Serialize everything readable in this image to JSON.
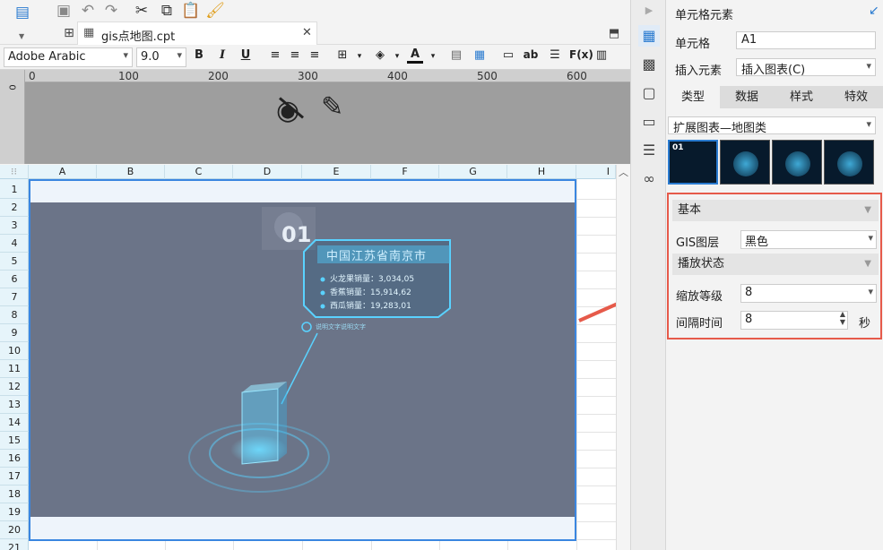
{
  "file_tab": {
    "name": "gis点地图.cpt"
  },
  "format_bar": {
    "font": "Adobe Arabic",
    "size": "9.0",
    "bold": "B",
    "italic": "I",
    "underline": "U",
    "fx": "F(x)"
  },
  "ruler": {
    "ticks": [
      "0",
      "100",
      "200",
      "300",
      "400",
      "500",
      "600"
    ]
  },
  "side_ruler": "0",
  "columns": [
    "A",
    "B",
    "C",
    "D",
    "E",
    "F",
    "G",
    "H",
    "I"
  ],
  "rows": [
    "1",
    "2",
    "3",
    "4",
    "5",
    "6",
    "7",
    "8",
    "9",
    "10",
    "11",
    "12",
    "13",
    "14",
    "15",
    "16",
    "17",
    "18",
    "19",
    "20",
    "21"
  ],
  "chart": {
    "badge": "01",
    "city": "中国江苏省南京市",
    "lines": [
      "火龙果销量：3,034,05",
      "香蕉销量：15,914,62",
      "西瓜销量：19,283,01"
    ],
    "note": "说明文字说明文字"
  },
  "panel": {
    "title": "单元格元素",
    "cell_label": "单元格",
    "cell_value": "A1",
    "insert_label": "插入元素",
    "insert_value": "插入图表(C)",
    "tabs": [
      "类型",
      "数据",
      "样式",
      "特效"
    ],
    "chart_type": "扩展图表—地图类",
    "thumb_badge": "01"
  },
  "settings": {
    "basic": "基本",
    "gis_label": "GIS图层",
    "gis_value": "黑色",
    "play_state": "播放状态",
    "zoom_label": "缩放等级",
    "zoom_value": "8",
    "interval_label": "间隔时间",
    "interval_value": "8",
    "interval_unit": "秒"
  },
  "colors": {
    "accent": "#2a7bd0",
    "highlight_border": "#e65a4a",
    "chart_bg": "#6b7488",
    "glow": "#5ad2ff"
  }
}
